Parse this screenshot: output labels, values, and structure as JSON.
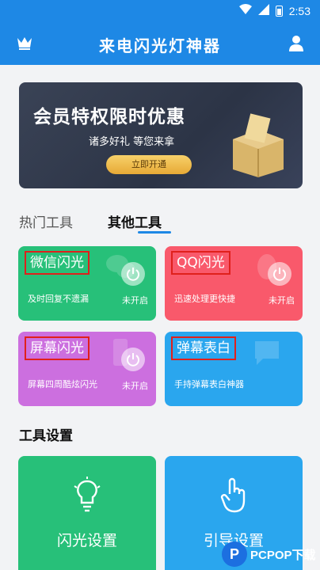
{
  "status_bar": {
    "time": "2:53"
  },
  "app_bar": {
    "title": "来电闪光灯神器"
  },
  "banner": {
    "title": "会员特权限时优惠",
    "subtitle": "诸多好礼 等您来拿",
    "button": "立即开通"
  },
  "tabs": [
    {
      "label": "热门工具"
    },
    {
      "label": "其他工具"
    }
  ],
  "tools": [
    {
      "title": "微信闪光",
      "subtitle": "及时回复不遗漏",
      "state": "未开启"
    },
    {
      "title": "QQ闪光",
      "subtitle": "迅速处理更快捷",
      "state": "未开启"
    },
    {
      "title": "屏幕闪光",
      "subtitle": "屏幕四周酷炫闪光",
      "state": "未开启"
    },
    {
      "title": "弹幕表白",
      "subtitle": "手持弹幕表白神器"
    }
  ],
  "settings": {
    "title": "工具设置",
    "items": [
      {
        "label": "闪光设置",
        "icon": "bulb-icon"
      },
      {
        "label": "引导设置",
        "icon": "hand-pointer-icon"
      }
    ]
  },
  "watermark": {
    "logo_letter": "P",
    "text": "PCPOP下载"
  },
  "colors": {
    "primary": "#1e88e5",
    "green": "#27c079",
    "red": "#f9596b",
    "purple": "#cc6fdf",
    "blue": "#2aa6ee",
    "highlight_box": "#e0201c"
  }
}
